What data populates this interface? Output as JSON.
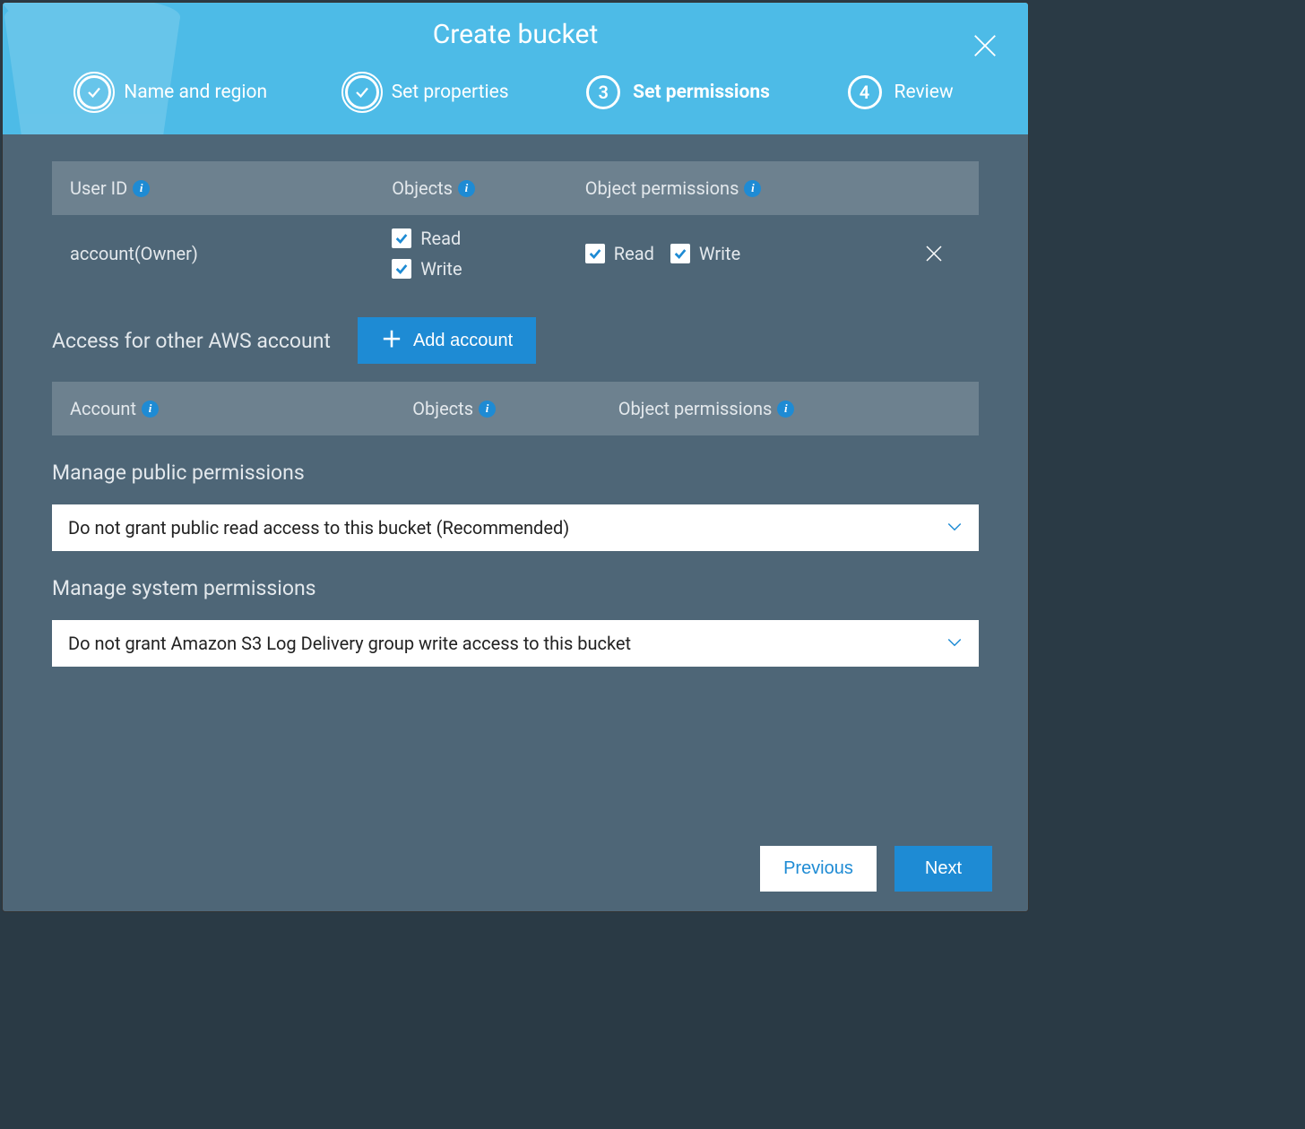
{
  "dialog": {
    "title": "Create bucket"
  },
  "stepper": {
    "steps": [
      {
        "label": "Name and region",
        "status": "complete"
      },
      {
        "label": "Set properties",
        "status": "complete"
      },
      {
        "label": "Set permissions",
        "status": "active",
        "num": "3"
      },
      {
        "label": "Review",
        "status": "upcoming",
        "num": "4"
      }
    ]
  },
  "user_grid": {
    "headers": {
      "user_id": "User ID",
      "objects": "Objects",
      "object_permissions": "Object permissions"
    },
    "row": {
      "user_id": "account(Owner)",
      "objects": {
        "read_label": "Read",
        "write_label": "Write",
        "read_checked": true,
        "write_checked": true
      },
      "object_permissions": {
        "read_label": "Read",
        "write_label": "Write",
        "read_checked": true,
        "write_checked": true
      }
    }
  },
  "other_account": {
    "label": "Access for other AWS account",
    "add_button": "Add account",
    "headers": {
      "account": "Account",
      "objects": "Objects",
      "object_permissions": "Object permissions"
    }
  },
  "public_permissions": {
    "heading": "Manage public permissions",
    "selected": "Do not grant public read access to this bucket (Recommended)"
  },
  "system_permissions": {
    "heading": "Manage system permissions",
    "selected": "Do not grant Amazon S3 Log Delivery group write access to this bucket"
  },
  "footer": {
    "previous": "Previous",
    "next": "Next"
  },
  "icons": {
    "info_glyph": "i"
  }
}
